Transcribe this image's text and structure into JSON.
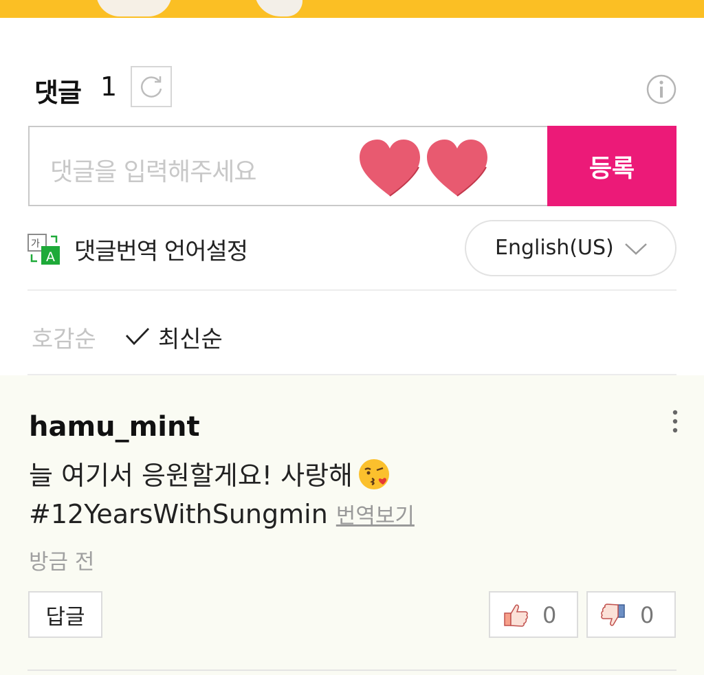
{
  "header": {
    "title": "댓글",
    "count": "1",
    "refresh_icon": "refresh-icon",
    "info_icon": "info-icon"
  },
  "input": {
    "placeholder": "댓글을 입력해주세요",
    "submit_label": "등록",
    "submit_color": "#ec1a78"
  },
  "translation": {
    "label": "댓글번역 언어설정",
    "language": "English(US)"
  },
  "sort": {
    "popular": "호감순",
    "latest": "최신순",
    "selected": "최신순"
  },
  "comment": {
    "username": "hamu_mint",
    "text_before_emoji": "늘 여기서 응원할게요! 사랑해",
    "emoji": "kissing-face-emoji",
    "text_after_emoji": "#12YearsWithSungmin",
    "translate_link": "번역보기",
    "timestamp": "방금 전",
    "reply_label": "답글",
    "likes": "0",
    "dislikes": "0"
  }
}
